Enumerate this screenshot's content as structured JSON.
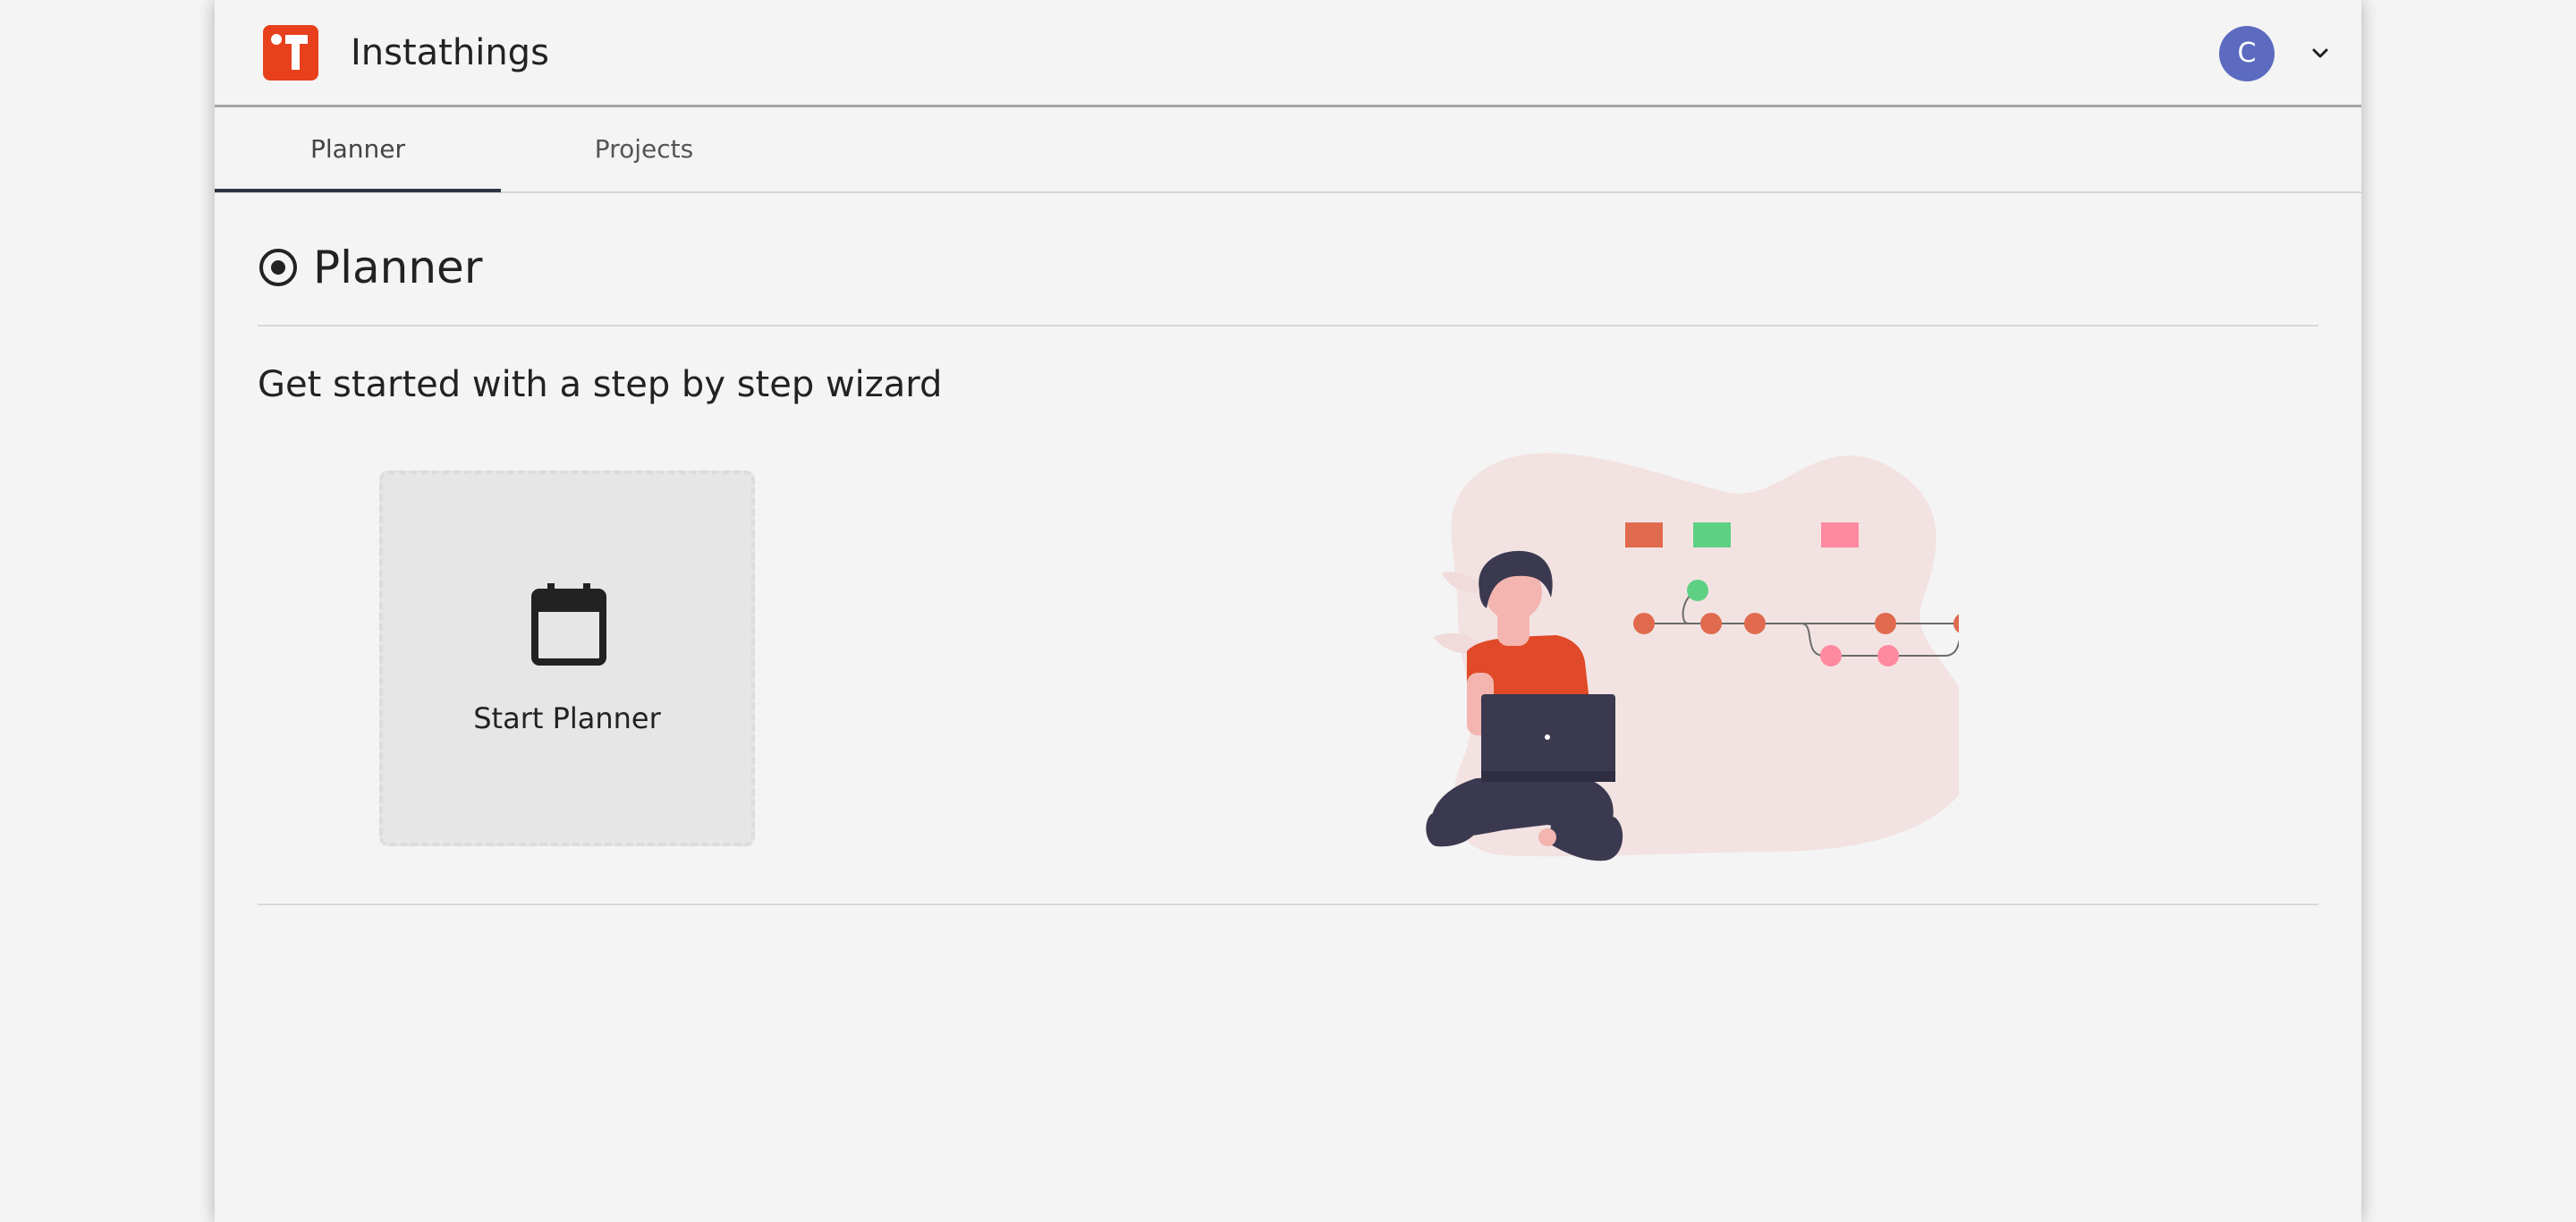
{
  "header": {
    "app_title": "Instathings",
    "avatar_initial": "C",
    "logo_icon": "instathings-logo-icon",
    "menu_icon": "chevron-down-icon"
  },
  "tabs": [
    {
      "label": "Planner",
      "active": true
    },
    {
      "label": "Projects",
      "active": false
    }
  ],
  "main": {
    "section_icon": "radio-target-icon",
    "title": "Planner",
    "subheading": "Get started with a step by step wizard",
    "start_card": {
      "icon": "calendar-icon",
      "label": "Start Planner"
    },
    "illustration": "person-with-laptop-timeline-illustration"
  },
  "colors": {
    "logo": "#e8401c",
    "avatar": "#5c6bc0",
    "active_tab_underline": "#2f3545",
    "illustration_orange": "#e06a4e",
    "illustration_green": "#5ed083",
    "illustration_pink": "#ff8aa0",
    "illustration_dark": "#3b3950"
  }
}
